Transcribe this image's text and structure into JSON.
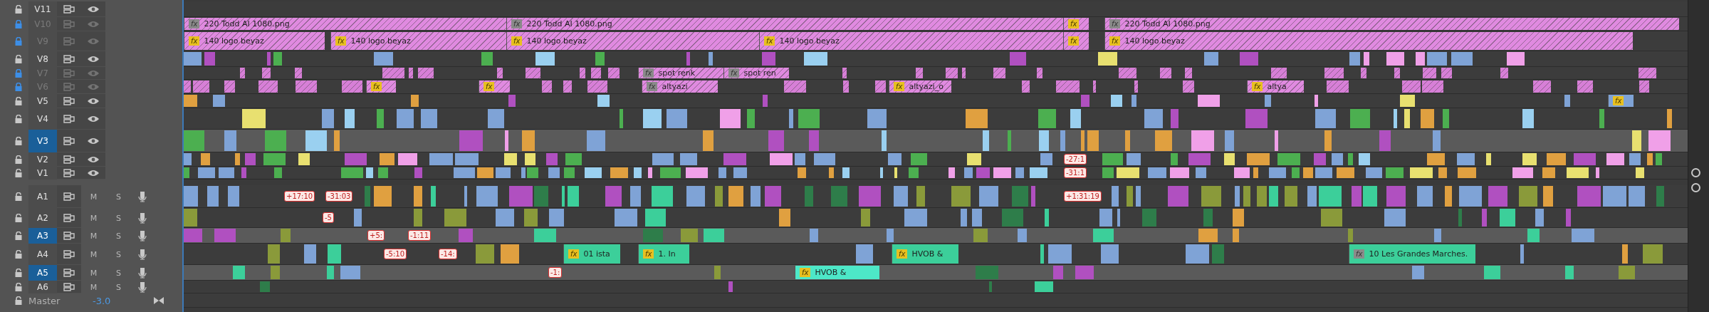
{
  "tracks": [
    {
      "name": "V11",
      "kind": "video",
      "locked": false,
      "enabled": true,
      "selected": false
    },
    {
      "name": "V10",
      "kind": "video",
      "locked": true,
      "enabled": false,
      "selected": false,
      "clips": [
        {
          "kind": "clip",
          "label": "220 Todd AI 1080.png",
          "badge": "fx",
          "badge_active": false,
          "color": "#e08ae0"
        },
        {
          "kind": "clip",
          "label": "220 Todd AI 1080.png",
          "badge": "fx",
          "badge_active": false,
          "color": "#e08ae0"
        },
        {
          "kind": "clip",
          "badge": "fx",
          "badge_active": true,
          "color": "#e08ae0"
        },
        {
          "kind": "clip",
          "label": "220 Todd AI 1080.png",
          "badge": "fx",
          "badge_active": false,
          "color": "#e08ae0"
        }
      ]
    },
    {
      "name": "V9",
      "kind": "video",
      "locked": true,
      "enabled": false,
      "selected": false,
      "clips": [
        {
          "kind": "clip",
          "label": "140 logo beyaz",
          "badge": "fx",
          "badge_active": true,
          "color": "#e08ae0"
        },
        {
          "kind": "clip",
          "label": "140 logo beyaz",
          "badge": "fx",
          "badge_active": true,
          "color": "#e08ae0"
        },
        {
          "kind": "clip",
          "label": "140 logo beyaz",
          "badge": "fx",
          "badge_active": true,
          "color": "#e08ae0"
        },
        {
          "kind": "clip",
          "label": "140 logo beyaz",
          "badge": "fx",
          "badge_active": true,
          "color": "#e08ae0"
        },
        {
          "kind": "clip",
          "badge": "fx",
          "badge_active": true,
          "color": "#e08ae0"
        },
        {
          "kind": "clip",
          "label": "140 logo beyaz",
          "badge": "fx",
          "badge_active": true,
          "color": "#e08ae0"
        }
      ]
    },
    {
      "name": "V8",
      "kind": "video",
      "locked": false,
      "enabled": true,
      "selected": false
    },
    {
      "name": "V7",
      "kind": "video",
      "locked": true,
      "enabled": false,
      "selected": false,
      "clips": [
        {
          "kind": "clip",
          "label": "spot renk",
          "badge": "fx",
          "badge_active": false,
          "color": "#e08ae0"
        },
        {
          "kind": "clip",
          "label": "spot ren",
          "badge": "fx",
          "badge_active": false,
          "color": "#e08ae0"
        }
      ]
    },
    {
      "name": "V6",
      "kind": "video",
      "locked": true,
      "enabled": false,
      "selected": false,
      "clips": [
        {
          "kind": "clip",
          "badge": "fx",
          "badge_active": true,
          "color": "#e08ae0"
        },
        {
          "kind": "clip",
          "badge": "fx",
          "badge_active": true,
          "color": "#e08ae0"
        },
        {
          "kind": "clip",
          "label": "altyazi",
          "badge": "fx",
          "badge_active": false,
          "color": "#e08ae0"
        },
        {
          "kind": "clip",
          "label": "altyazi_o",
          "badge": "fx",
          "badge_active": true,
          "color": "#e08ae0"
        },
        {
          "kind": "clip",
          "label": "altya",
          "badge": "fx",
          "badge_active": true,
          "color": "#e08ae0"
        }
      ]
    },
    {
      "name": "V5",
      "kind": "video",
      "locked": false,
      "enabled": true,
      "selected": false,
      "clips": [
        {
          "kind": "clip",
          "badge": "fx",
          "badge_active": true,
          "color": "#7fa3d6"
        }
      ]
    },
    {
      "name": "V4",
      "kind": "video",
      "locked": false,
      "enabled": true,
      "selected": false
    },
    {
      "name": "V3",
      "kind": "video",
      "locked": false,
      "enabled": true,
      "selected": true
    },
    {
      "name": "V2",
      "kind": "video",
      "locked": false,
      "enabled": true,
      "selected": false,
      "clips": [
        {
          "kind": "offset",
          "label": "-27:1"
        }
      ]
    },
    {
      "name": "V1",
      "kind": "video",
      "locked": false,
      "enabled": true,
      "selected": false,
      "clips": [
        {
          "kind": "offset",
          "label": "-31:1"
        }
      ]
    },
    {
      "name": "A1",
      "kind": "audio",
      "locked": false,
      "enabled": true,
      "selected": false,
      "mute": "M",
      "solo": "S",
      "clips": [
        {
          "kind": "offset",
          "label": "+17:10"
        },
        {
          "kind": "offset",
          "label": "-31:03"
        },
        {
          "kind": "offset",
          "label": "+1:31:19"
        }
      ]
    },
    {
      "name": "A2",
      "kind": "audio",
      "locked": false,
      "enabled": true,
      "selected": false,
      "mute": "M",
      "solo": "S",
      "clips": [
        {
          "kind": "offset",
          "label": "-5"
        }
      ]
    },
    {
      "name": "A3",
      "kind": "audio",
      "locked": false,
      "enabled": true,
      "selected": true,
      "mute": "M",
      "solo": "S",
      "clips": [
        {
          "kind": "offset",
          "label": "+5:"
        },
        {
          "kind": "offset",
          "label": "-1:11"
        }
      ]
    },
    {
      "name": "A4",
      "kind": "audio",
      "locked": false,
      "enabled": true,
      "selected": false,
      "mute": "M",
      "solo": "S",
      "clips": [
        {
          "kind": "offset",
          "label": "-5:10"
        },
        {
          "kind": "offset",
          "label": "-14:"
        },
        {
          "kind": "clip",
          "label": "01 ista",
          "badge": "fx",
          "badge_active": true,
          "color": "#3ccf9a"
        },
        {
          "kind": "clip",
          "label": "1. In",
          "badge": "fx",
          "badge_active": true,
          "color": "#3ccf9a"
        },
        {
          "kind": "clip",
          "label": "HVOB &",
          "badge": "fx",
          "badge_active": true,
          "color": "#3ccf9a"
        },
        {
          "kind": "clip",
          "label": "10 Les Grandes Marches.",
          "badge": "fx",
          "badge_active": false,
          "color": "#3ccf9a"
        }
      ]
    },
    {
      "name": "A5",
      "kind": "audio",
      "locked": false,
      "enabled": true,
      "selected": true,
      "mute": "M",
      "solo": "S",
      "clips": [
        {
          "kind": "offset",
          "label": "-1:"
        },
        {
          "kind": "clip",
          "label": "HVOB &",
          "badge": "fx",
          "badge_active": true,
          "color": "#4de8c8"
        }
      ]
    },
    {
      "name": "A6",
      "kind": "audio",
      "locked": false,
      "enabled": true,
      "selected": false,
      "mute": "M",
      "solo": "S"
    }
  ],
  "master": {
    "name": "Master",
    "volume": "-3.0"
  }
}
